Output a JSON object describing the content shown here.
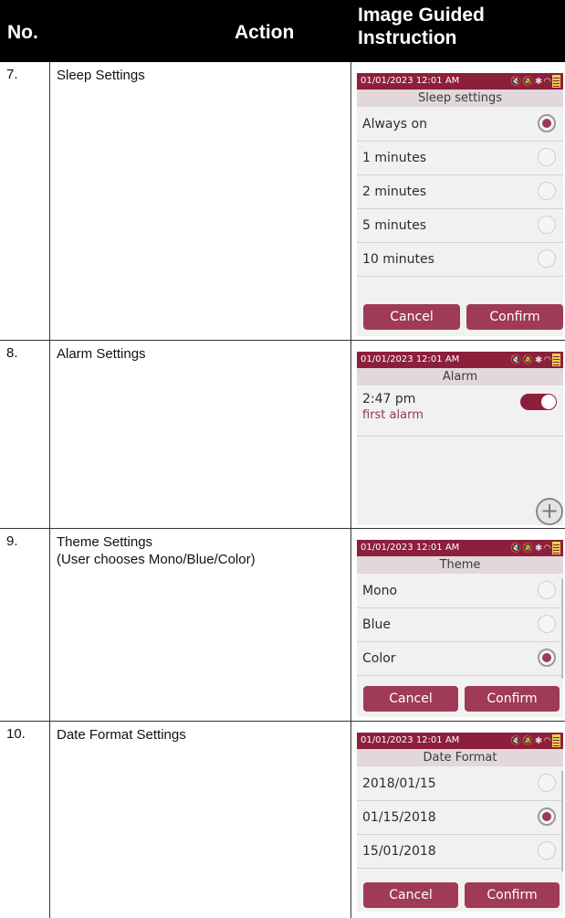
{
  "header": {
    "no": "No.",
    "action": "Action",
    "image_guided_line1": "Image Guided",
    "image_guided_line2": "Instruction"
  },
  "rows": [
    {
      "no": "7.",
      "action": "Sleep Settings",
      "screen": {
        "datetime": "01/01/2023 12:01 AM",
        "title": "Sleep settings",
        "options": [
          {
            "label": "Always on",
            "selected": true
          },
          {
            "label": "1 minutes",
            "selected": false
          },
          {
            "label": "2 minutes",
            "selected": false
          },
          {
            "label": "5 minutes",
            "selected": false
          },
          {
            "label": "10 minutes",
            "selected": false
          }
        ],
        "cancel": "Cancel",
        "confirm": "Confirm"
      }
    },
    {
      "no": "8.",
      "action": "Alarm Settings",
      "screen": {
        "datetime": "01/01/2023 12:01 AM",
        "title": "Alarm",
        "alarm_time": "2:47 pm",
        "alarm_name": "first alarm",
        "add": "+"
      }
    },
    {
      "no": "9.",
      "action": "Theme Settings",
      "action_sub": "(User chooses Mono/Blue/Color)",
      "screen": {
        "datetime": "01/01/2023 12:01 AM",
        "title": "Theme",
        "options": [
          {
            "label": "Mono",
            "selected": false
          },
          {
            "label": "Blue",
            "selected": false
          },
          {
            "label": "Color",
            "selected": true
          }
        ],
        "cancel": "Cancel",
        "confirm": "Confirm"
      }
    },
    {
      "no": "10.",
      "action": "Date Format Settings",
      "screen": {
        "datetime": "01/01/2023 12:01 AM",
        "title": "Date Format",
        "options": [
          {
            "label": "2018/01/15",
            "selected": false
          },
          {
            "label": "01/15/2018",
            "selected": true
          },
          {
            "label": "15/01/2018",
            "selected": false
          }
        ],
        "cancel": "Cancel",
        "confirm": "Confirm"
      }
    }
  ],
  "status_icons": [
    "mute-icon",
    "bell-off-icon",
    "bluetooth-icon",
    "wifi-icon",
    "battery-icon"
  ],
  "colors": {
    "accent": "#8c1f3c",
    "button": "#9f3b57",
    "title_bar": "#e2d7da"
  }
}
